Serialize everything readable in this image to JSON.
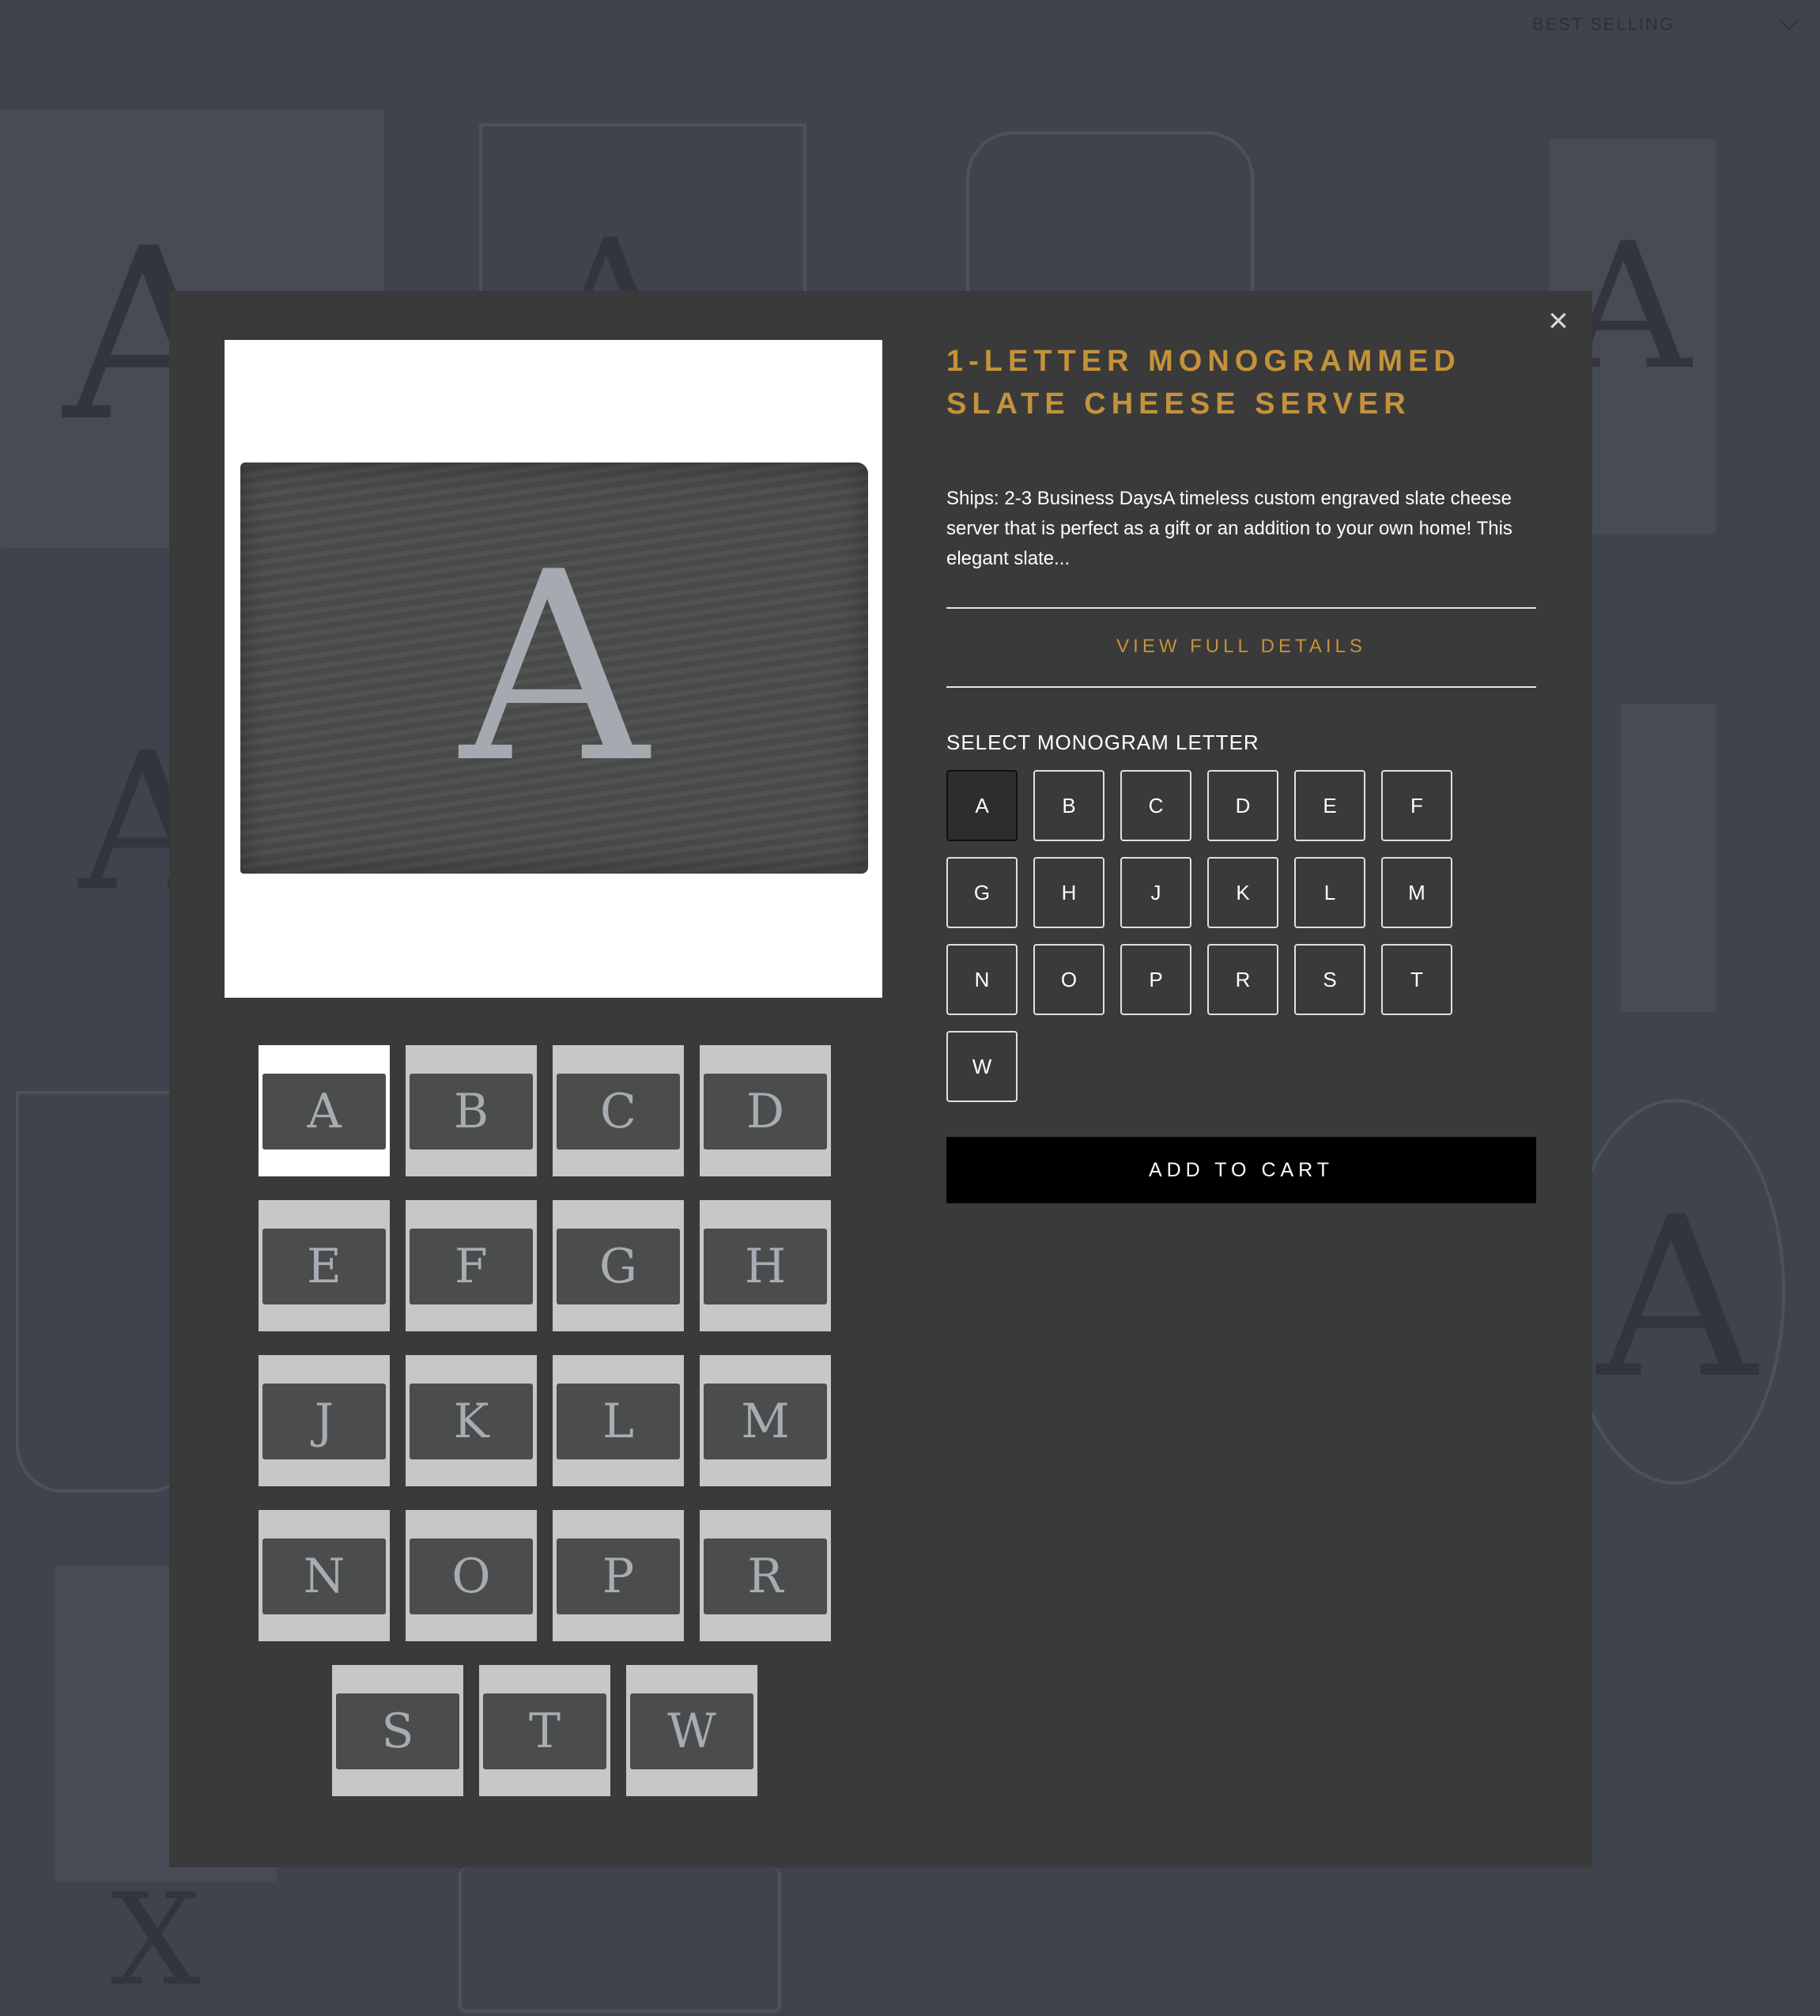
{
  "background": {
    "sort_label": "BEST SELLING"
  },
  "modal": {
    "close_glyph": "×",
    "title": "1-LETTER MONOGRAMMED SLATE CHEESE SERVER",
    "description": "Ships: 2-3 Business DaysA timeless custom engraved slate cheese server that is perfect as a gift or an addition to your own home! This elegant slate...",
    "view_details_label": "VIEW FULL DETAILS",
    "select_label": "SELECT MONOGRAM LETTER",
    "letters": [
      "A",
      "B",
      "C",
      "D",
      "E",
      "F",
      "G",
      "H",
      "J",
      "K",
      "L",
      "M",
      "N",
      "O",
      "P",
      "R",
      "S",
      "T",
      "W"
    ],
    "selected_letter": "A",
    "add_to_cart_label": "ADD TO CART",
    "thumbnails": [
      "A",
      "B",
      "C",
      "D",
      "E",
      "F",
      "G",
      "H",
      "J",
      "K",
      "L",
      "M",
      "N",
      "O",
      "P",
      "R",
      "S",
      "T",
      "W"
    ],
    "active_thumbnail": "A"
  },
  "colors": {
    "accent_gold": "#c4923b",
    "modal_bg": "#3a3a3a",
    "overlay_bg": "#3f434d",
    "button_black": "#000000"
  }
}
